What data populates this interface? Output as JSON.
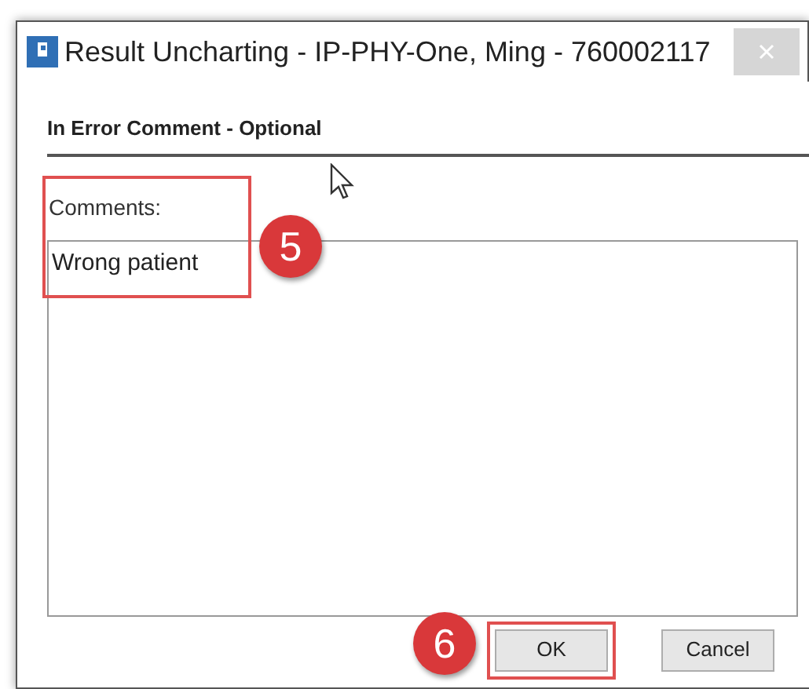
{
  "window": {
    "title": "Result Uncharting - IP-PHY-One, Ming - 760002117"
  },
  "section": {
    "title": "In Error Comment - Optional"
  },
  "comments": {
    "label": "Comments:",
    "value": "Wrong patient"
  },
  "buttons": [
    {
      "label": "OK",
      "highlighted": true
    },
    {
      "label": "Cancel",
      "highlighted": false
    }
  ],
  "callouts": [
    {
      "number": "5"
    },
    {
      "number": "6"
    }
  ]
}
